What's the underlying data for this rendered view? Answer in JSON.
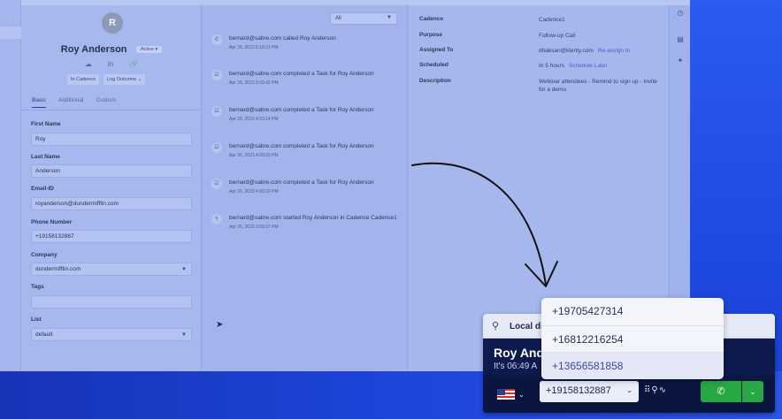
{
  "contact": {
    "initial": "R",
    "name": "Roy Anderson",
    "status": "Active ▾",
    "in_cadence_label": "In Cadence",
    "log_outcome_label": "Log Outcome ⌄",
    "tabs": [
      "Basic",
      "Additional",
      "Custom"
    ],
    "fields": [
      {
        "label": "First Name",
        "value": "Roy"
      },
      {
        "label": "Last Name",
        "value": "Anderson"
      },
      {
        "label": "Email-ID",
        "value": "royanderson@dundermifflin.com"
      },
      {
        "label": "Phone Number",
        "value": "+19158132887"
      },
      {
        "label": "Company",
        "value": "dundermifflin.com"
      },
      {
        "label": "Tags",
        "value": ""
      },
      {
        "label": "List",
        "value": "default"
      }
    ]
  },
  "feed": {
    "filter": "All",
    "items": [
      {
        "text": "bernard@sabre.com called Roy Anderson",
        "time": "Apr 26, 2023 5:18:21 PM"
      },
      {
        "text": "bernard@sabre.com completed a Task for Roy Anderson",
        "time": "Apr 26, 2023 5:03:42 PM"
      },
      {
        "text": "bernard@sabre.com completed a Task for Roy Anderson",
        "time": "Apr 26, 2023 4:03:14 PM"
      },
      {
        "text": "bernard@sabre.com completed a Task for Roy Anderson",
        "time": "Apr 26, 2023 4:00:29 PM"
      },
      {
        "text": "bernard@sabre.com completed a Task for Roy Anderson",
        "time": "Apr 26, 2023 4:00:22 PM"
      },
      {
        "text": "bernard@sabre.com started Roy Anderson in Cadence Cadence1",
        "time": "Apr 26, 2023 3:59:37 PM"
      }
    ]
  },
  "details": {
    "rows": [
      {
        "key": "Cadence",
        "value": "Cadence1",
        "link": ""
      },
      {
        "key": "Purpose",
        "value": "Follow-up Call",
        "link": ""
      },
      {
        "key": "Assigned To",
        "value": "dhaksan@klenty.com",
        "link": "Re-assign to"
      },
      {
        "key": "Scheduled",
        "value": "In 5 hours",
        "link": "Schedule Later"
      },
      {
        "key": "Description",
        "value": "Webinar attendees - Remind to sign up - Invite for a demo",
        "link": ""
      }
    ]
  },
  "dialer": {
    "header_label": "Local di",
    "caller_name": "Roy And",
    "caller_time": "It's 06:49 A",
    "from_number": "+19158132887",
    "options": [
      "+19705427314",
      "+16812216254",
      "+13656581858"
    ],
    "selected_index": 2
  },
  "colors": {
    "accent_blue": "#1a3fd0",
    "call_green": "#28a745",
    "dialer_dark": "#0c1a4d"
  }
}
